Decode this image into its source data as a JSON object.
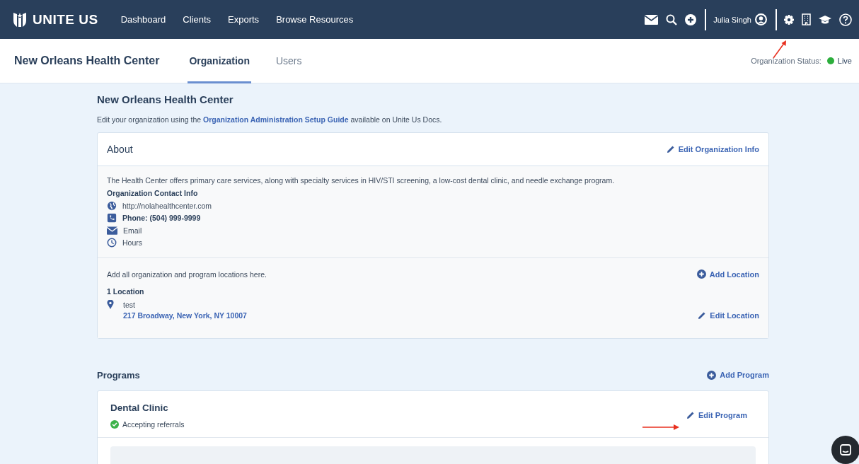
{
  "top_nav": {
    "logo_text": "UNITE US",
    "items": [
      "Dashboard",
      "Clients",
      "Exports",
      "Browse Resources"
    ],
    "user": "Julia Singh"
  },
  "sub_header": {
    "org_name": "New Orleans Health Center",
    "tabs": [
      {
        "label": "Organization",
        "selected": true
      },
      {
        "label": "Users",
        "selected": false
      }
    ],
    "status_label": "Organization Status:",
    "status": "Live"
  },
  "page": {
    "title": "New Orleans Health Center",
    "intro_before": "Edit your organization using the",
    "intro_link": "Organization Administration Setup Guide",
    "intro_after": "available on Unite Us Docs."
  },
  "about": {
    "title": "About",
    "edit": "Edit Organization Info",
    "description": "The Health Center offers primary care services, along with specialty services in HIV/STI screening, a low-cost dental clinic, and needle exchange program.",
    "contact_title": "Organization Contact Info",
    "contacts": [
      {
        "kind": "web",
        "text": "http://nolahealthcenter.com",
        "bold": false
      },
      {
        "kind": "phone",
        "text": "Phone: (504) 999-9999",
        "bold": true
      },
      {
        "kind": "email",
        "text": "Email",
        "bold": false
      },
      {
        "kind": "hours",
        "text": "Hours",
        "bold": false
      }
    ],
    "locations_hint": "Add all organization and program locations here.",
    "add_location": "Add Location",
    "location_count": "1 Location",
    "location_name": "test",
    "location_address": "217 Broadway, New York, NY 10007",
    "edit_location": "Edit Location"
  },
  "programs": {
    "title": "Programs",
    "add": "Add Program",
    "items": [
      {
        "name": "Dental Clinic",
        "accepting": true,
        "status": "Accepting referrals",
        "edit": "Edit Program"
      }
    ]
  }
}
